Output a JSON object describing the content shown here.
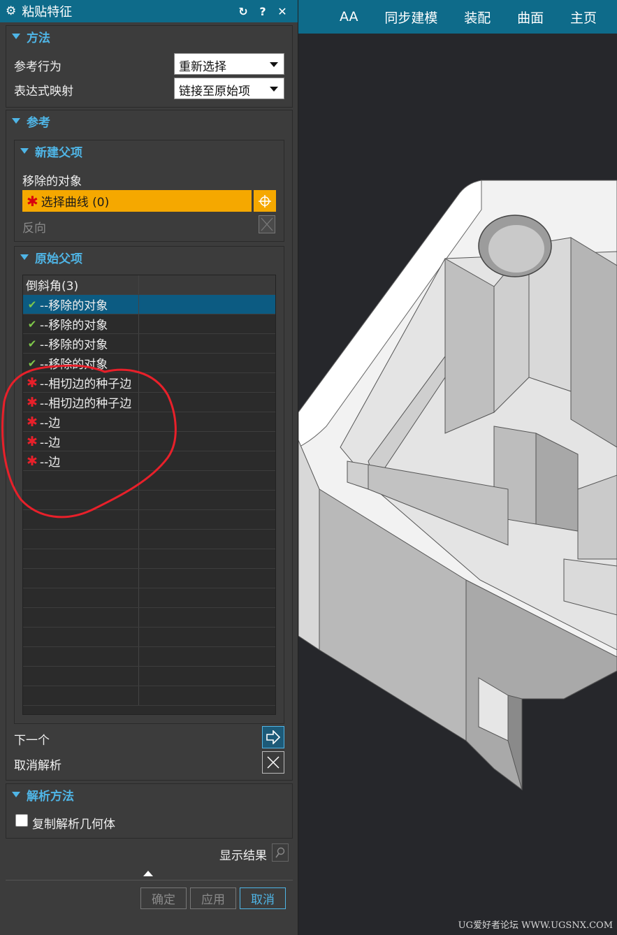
{
  "viewport_tabs": [
    "AA",
    "同步建模",
    "装配",
    "曲面",
    "主页"
  ],
  "watermark": "UG爱好者论坛 WWW.UGSNX.COM",
  "dialog": {
    "title": "粘贴特征",
    "gear_icon": "gear-icon",
    "reset_icon": "reset-icon",
    "help_label": "?",
    "close_label": "✕"
  },
  "method": {
    "header": "方法",
    "ref_behavior_label": "参考行为",
    "ref_behavior_value": "重新选择",
    "expr_map_label": "表达式映射",
    "expr_map_value": "链接至原始项"
  },
  "reference": {
    "header": "参考",
    "new_parent": {
      "header": "新建父项",
      "removed_label": "移除的对象",
      "select_curve": "选择曲线 (0)",
      "reverse_label": "反向"
    },
    "original_parent": {
      "header": "原始父项",
      "rows": [
        {
          "icon": "",
          "text": "倒斜角(3)",
          "kind": "head"
        },
        {
          "icon": "check",
          "text": "--移除的对象",
          "kind": "sel"
        },
        {
          "icon": "check",
          "text": "--移除的对象",
          "kind": ""
        },
        {
          "icon": "check",
          "text": "--移除的对象",
          "kind": ""
        },
        {
          "icon": "check",
          "text": "--移除的对象",
          "kind": ""
        },
        {
          "icon": "star",
          "text": "--相切边的种子边",
          "kind": ""
        },
        {
          "icon": "star",
          "text": "--相切边的种子边",
          "kind": ""
        },
        {
          "icon": "star",
          "text": "--边",
          "kind": ""
        },
        {
          "icon": "star",
          "text": "--边",
          "kind": ""
        },
        {
          "icon": "star",
          "text": "--边",
          "kind": ""
        }
      ]
    },
    "next_label": "下一个",
    "unresolve_label": "取消解析"
  },
  "resolve_method": {
    "header": "解析方法",
    "copy_geometry_label": "复制解析几何体"
  },
  "show_result_label": "显示结果",
  "buttons": {
    "ok": "确定",
    "apply": "应用",
    "cancel": "取消"
  },
  "annotation_color": "#e8202a",
  "accent_color": "#0e6b8a"
}
